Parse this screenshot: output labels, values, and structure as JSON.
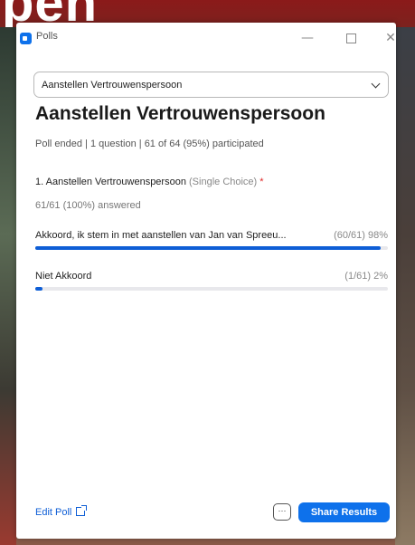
{
  "background": {
    "text": "pen"
  },
  "window": {
    "app_title": "Polls",
    "app_icon": "zoom-camera-icon",
    "controls": {
      "minimize": "—",
      "close": "✕"
    }
  },
  "poll_select": {
    "value": "Aanstellen Vertrouwenspersoon"
  },
  "poll": {
    "title": "Aanstellen Vertrouwenspersoon",
    "meta": "Poll ended | 1 question | 61 of 64 (95%) participated",
    "question": {
      "text": "1. Aanstellen Vertrouwenspersoon",
      "type": "(Single Choice)",
      "required_mark": "*",
      "answered": "61/61 (100%) answered"
    },
    "options": [
      {
        "label": "Akkoord, ik stem in met aanstellen van Jan van Spreeu...",
        "stat": "(60/61) 98%",
        "share": 0.98
      },
      {
        "label": "Niet Akkoord",
        "stat": "(1/61) 2%",
        "share": 0.02
      }
    ]
  },
  "footer": {
    "edit_label": "Edit Poll",
    "more_label": "···",
    "share_label": "Share Results"
  },
  "colors": {
    "accent": "#0e71eb",
    "bar": "#0e5ed6",
    "required": "#e02828"
  }
}
